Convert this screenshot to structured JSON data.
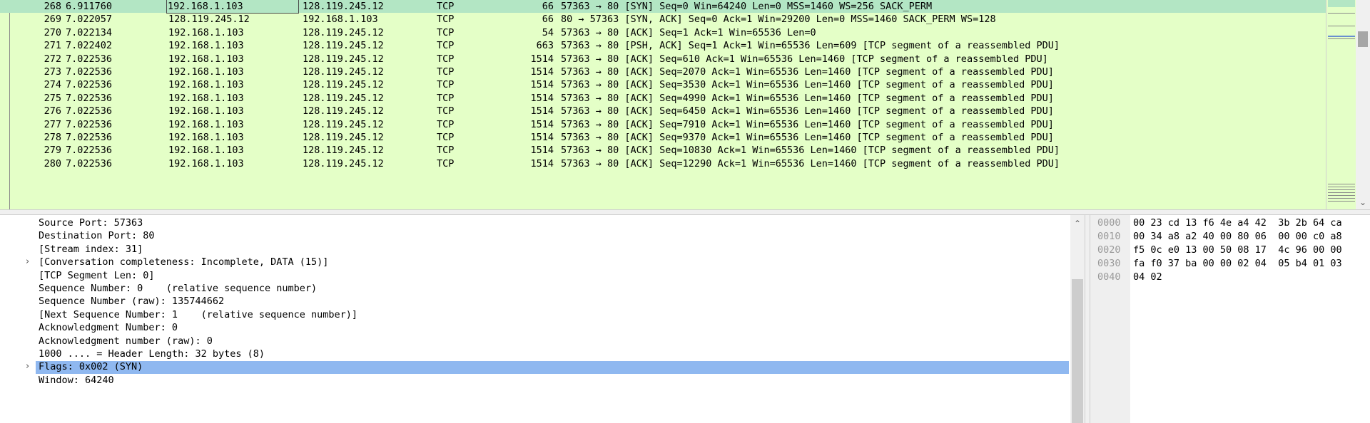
{
  "packet_list": {
    "rows": [
      {
        "no": "268",
        "time": "6.911760",
        "src": "192.168.1.103",
        "dst": "128.119.245.12",
        "proto": "TCP",
        "len": "66",
        "info": "57363 → 80 [SYN] Seq=0 Win=64240 Len=0 MSS=1460 WS=256 SACK_PERM"
      },
      {
        "no": "269",
        "time": "7.022057",
        "src": "128.119.245.12",
        "dst": "192.168.1.103",
        "proto": "TCP",
        "len": "66",
        "info": "80 → 57363 [SYN, ACK] Seq=0 Ack=1 Win=29200 Len=0 MSS=1460 SACK_PERM WS=128"
      },
      {
        "no": "270",
        "time": "7.022134",
        "src": "192.168.1.103",
        "dst": "128.119.245.12",
        "proto": "TCP",
        "len": "54",
        "info": "57363 → 80 [ACK] Seq=1 Ack=1 Win=65536 Len=0"
      },
      {
        "no": "271",
        "time": "7.022402",
        "src": "192.168.1.103",
        "dst": "128.119.245.12",
        "proto": "TCP",
        "len": "663",
        "info": "57363 → 80 [PSH, ACK] Seq=1 Ack=1 Win=65536 Len=609 [TCP segment of a reassembled PDU]"
      },
      {
        "no": "272",
        "time": "7.022536",
        "src": "192.168.1.103",
        "dst": "128.119.245.12",
        "proto": "TCP",
        "len": "1514",
        "info": "57363 → 80 [ACK] Seq=610 Ack=1 Win=65536 Len=1460 [TCP segment of a reassembled PDU]"
      },
      {
        "no": "273",
        "time": "7.022536",
        "src": "192.168.1.103",
        "dst": "128.119.245.12",
        "proto": "TCP",
        "len": "1514",
        "info": "57363 → 80 [ACK] Seq=2070 Ack=1 Win=65536 Len=1460 [TCP segment of a reassembled PDU]"
      },
      {
        "no": "274",
        "time": "7.022536",
        "src": "192.168.1.103",
        "dst": "128.119.245.12",
        "proto": "TCP",
        "len": "1514",
        "info": "57363 → 80 [ACK] Seq=3530 Ack=1 Win=65536 Len=1460 [TCP segment of a reassembled PDU]"
      },
      {
        "no": "275",
        "time": "7.022536",
        "src": "192.168.1.103",
        "dst": "128.119.245.12",
        "proto": "TCP",
        "len": "1514",
        "info": "57363 → 80 [ACK] Seq=4990 Ack=1 Win=65536 Len=1460 [TCP segment of a reassembled PDU]"
      },
      {
        "no": "276",
        "time": "7.022536",
        "src": "192.168.1.103",
        "dst": "128.119.245.12",
        "proto": "TCP",
        "len": "1514",
        "info": "57363 → 80 [ACK] Seq=6450 Ack=1 Win=65536 Len=1460 [TCP segment of a reassembled PDU]"
      },
      {
        "no": "277",
        "time": "7.022536",
        "src": "192.168.1.103",
        "dst": "128.119.245.12",
        "proto": "TCP",
        "len": "1514",
        "info": "57363 → 80 [ACK] Seq=7910 Ack=1 Win=65536 Len=1460 [TCP segment of a reassembled PDU]"
      },
      {
        "no": "278",
        "time": "7.022536",
        "src": "192.168.1.103",
        "dst": "128.119.245.12",
        "proto": "TCP",
        "len": "1514",
        "info": "57363 → 80 [ACK] Seq=9370 Ack=1 Win=65536 Len=1460 [TCP segment of a reassembled PDU]"
      },
      {
        "no": "279",
        "time": "7.022536",
        "src": "192.168.1.103",
        "dst": "128.119.245.12",
        "proto": "TCP",
        "len": "1514",
        "info": "57363 → 80 [ACK] Seq=10830 Ack=1 Win=65536 Len=1460 [TCP segment of a reassembled PDU]"
      },
      {
        "no": "280",
        "time": "7.022536",
        "src": "192.168.1.103",
        "dst": "128.119.245.12",
        "proto": "TCP",
        "len": "1514",
        "info": "57363 → 80 [ACK] Seq=12290 Ack=1 Win=65536 Len=1460 [TCP segment of a reassembled PDU]"
      }
    ]
  },
  "details": {
    "rows": [
      {
        "text": "Source Port: 57363"
      },
      {
        "text": "Destination Port: 80"
      },
      {
        "text": "[Stream index: 31]"
      },
      {
        "text": "[Conversation completeness: Incomplete, DATA (15)]",
        "expander": "›"
      },
      {
        "text": "[TCP Segment Len: 0]"
      },
      {
        "text": "Sequence Number: 0    (relative sequence number)"
      },
      {
        "text": "Sequence Number (raw): 135744662"
      },
      {
        "text": "[Next Sequence Number: 1    (relative sequence number)]"
      },
      {
        "text": "Acknowledgment Number: 0"
      },
      {
        "text": "Acknowledgment number (raw): 0"
      },
      {
        "text": "1000 .... = Header Length: 32 bytes (8)"
      },
      {
        "text": "Flags: 0x002 (SYN)",
        "expander": "›"
      },
      {
        "text": "Window: 64240"
      }
    ]
  },
  "hex": {
    "rows": [
      {
        "offset": "0000",
        "bytes": "00 23 cd 13 f6 4e a4 42  3b 2b 64 ca"
      },
      {
        "offset": "0010",
        "bytes": "00 34 a8 a2 40 00 80 06  00 00 c0 a8"
      },
      {
        "offset": "0020",
        "bytes": "f5 0c e0 13 00 50 08 17  4c 96 00 00"
      },
      {
        "offset": "0030",
        "bytes": "fa f0 37 ba 00 00 02 04  05 b4 01 03"
      },
      {
        "offset": "0040",
        "bytes": "04 02"
      }
    ]
  },
  "colors": {
    "tcp_row": "#e4ffc7",
    "selected_packet": "#b3e6c4",
    "selected_detail": "#8fb8f0"
  }
}
